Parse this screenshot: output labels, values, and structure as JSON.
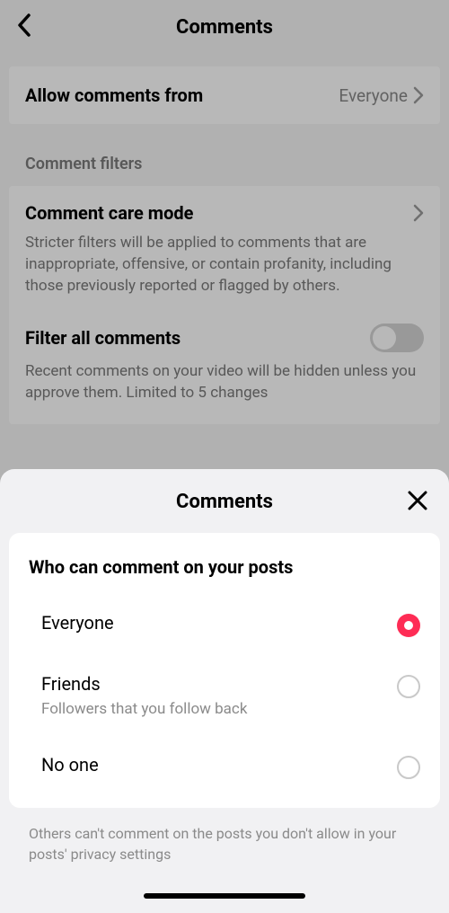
{
  "header": {
    "title": "Comments"
  },
  "allowFrom": {
    "label": "Allow comments from",
    "value": "Everyone"
  },
  "filtersSection": {
    "title": "Comment filters"
  },
  "careMode": {
    "title": "Comment care mode",
    "desc": "Stricter filters will be applied to comments that are inappropriate, offensive, or contain profanity, including those previously reported or flagged by others."
  },
  "filterAll": {
    "title": "Filter all comments",
    "desc": "Recent comments on your video will be hidden unless you approve them. Limited to 5 changes"
  },
  "sheet": {
    "title": "Comments",
    "cardTitle": "Who can comment on your posts",
    "options": [
      {
        "label": "Everyone",
        "sub": "",
        "selected": true
      },
      {
        "label": "Friends",
        "sub": "Followers that you follow back",
        "selected": false
      },
      {
        "label": "No one",
        "sub": "",
        "selected": false
      }
    ],
    "footer": "Others can't comment on the posts you don't allow in your posts' privacy settings"
  }
}
